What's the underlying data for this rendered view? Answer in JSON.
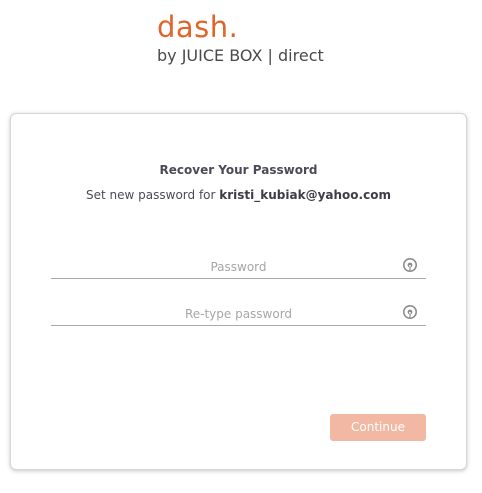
{
  "brand": {
    "logo": "dash.",
    "tagline": "by JUICE BOX | direct",
    "accent_color": "#e0652b"
  },
  "card": {
    "title": "Recover Your Password",
    "subtitle_prefix": "Set new password for",
    "email": "kristi_kubiak@yahoo.com"
  },
  "form": {
    "password": {
      "placeholder": "Password",
      "value": "",
      "icon": "eye-icon"
    },
    "retype": {
      "placeholder": "Re-type password",
      "value": "",
      "icon": "eye-icon"
    },
    "continue_label": "Continue",
    "continue_color": "#f3b8a3"
  }
}
